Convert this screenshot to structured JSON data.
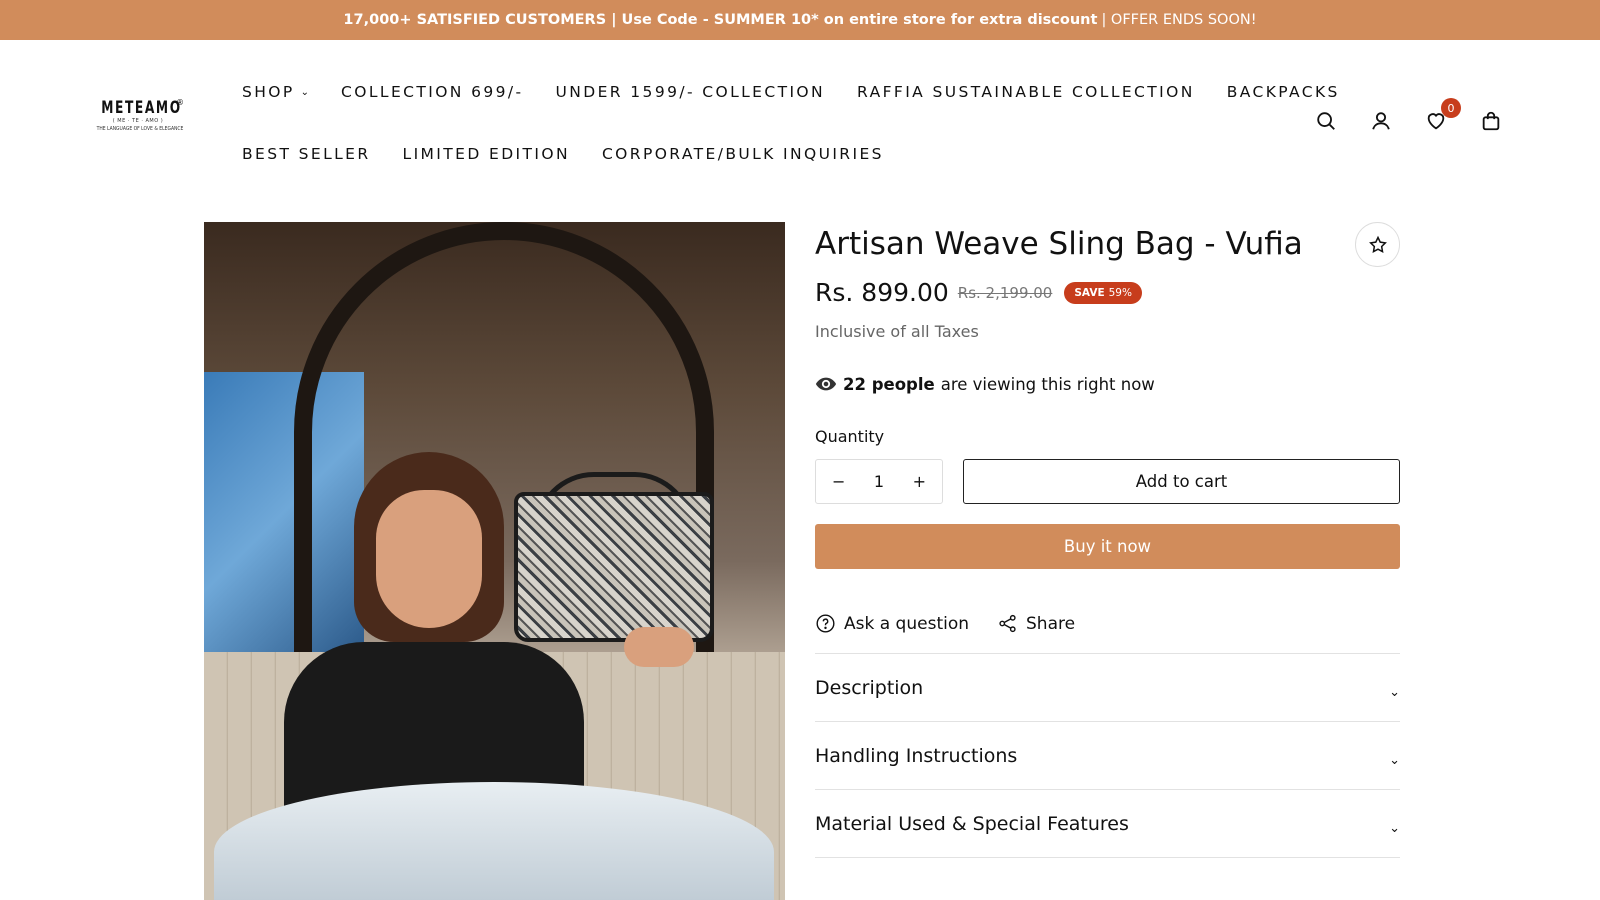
{
  "announcement": {
    "bold_text": "17,000+ SATISFIED CUSTOMERS | Use Code - SUMMER 10* on entire store for extra discount",
    "thin_text": "| OFFER ENDS SOON!",
    "bg_color": "#d18c5b"
  },
  "logo": {
    "word": "METEAMO",
    "sub": "( ME · TE · AMO )",
    "tagline": "THE LANGUAGE OF LOVE & ELEGANCE",
    "reg": "®"
  },
  "nav": {
    "row1": [
      {
        "label": "SHOP",
        "has_dropdown": true
      },
      {
        "label": "COLLECTION 699/-"
      },
      {
        "label": "UNDER 1599/- COLLECTION"
      },
      {
        "label": "RAFFIA SUSTAINABLE COLLECTION"
      },
      {
        "label": "BACKPACKS"
      }
    ],
    "row2": [
      {
        "label": "BEST SELLER"
      },
      {
        "label": "LIMITED EDITION"
      },
      {
        "label": "CORPORATE/BULK INQUIRIES"
      }
    ],
    "dropdown_glyph": "⌄"
  },
  "header_icons": {
    "search": "search-icon",
    "account": "user-icon",
    "wishlist": "heart-icon",
    "wishlist_count": "0",
    "cart": "bag-icon"
  },
  "product": {
    "title": "Artisan Weave Sling Bag - Vufia",
    "price": "Rs. 899.00",
    "compare_price": "Rs. 2,199.00",
    "save_label": "SAVE",
    "save_percent": "59%",
    "tax_note": "Inclusive of all Taxes",
    "viewers_count": "22 people",
    "viewers_text": "are viewing this right now",
    "quantity_label": "Quantity",
    "quantity_value": "1",
    "minus": "−",
    "plus": "+",
    "add_to_cart": "Add to cart",
    "buy_now": "Buy it now",
    "ask_question": "Ask a question",
    "share": "Share",
    "accordions": [
      {
        "label": "Description"
      },
      {
        "label": "Handling Instructions"
      },
      {
        "label": "Material Used & Special Features"
      }
    ],
    "accordion_glyph": "⌄",
    "accent_color": "#d18c5b",
    "badge_color": "#c73d1c"
  }
}
